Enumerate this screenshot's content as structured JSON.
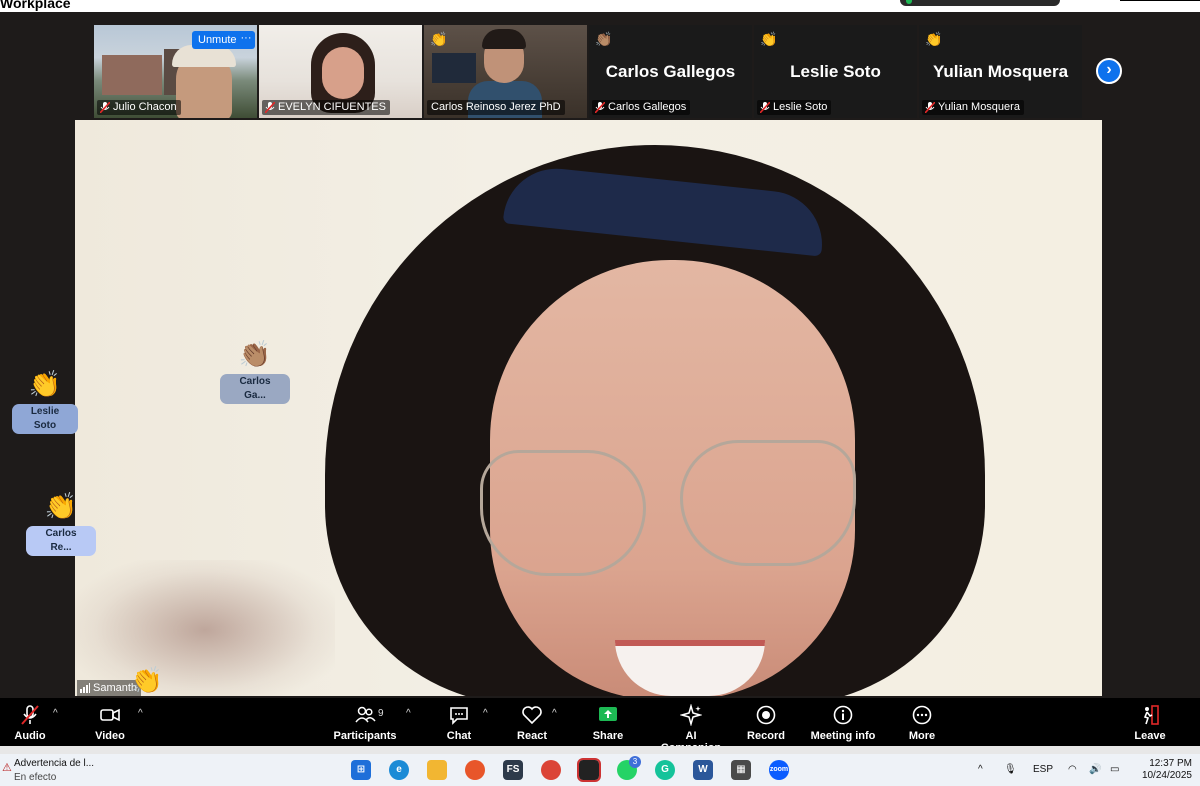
{
  "app": {
    "title": "Workplace"
  },
  "thumbnails": [
    {
      "name": "Julio Chacon",
      "kind": "video",
      "muted": true,
      "unmute_label": "Unmute",
      "more_label": "···"
    },
    {
      "name": "EVELYN CIFUENTES",
      "kind": "video",
      "muted": true
    },
    {
      "name": "Carlos Reinoso Jerez PhD",
      "kind": "video",
      "muted": false,
      "reaction": "👏"
    },
    {
      "name": "Carlos Gallegos",
      "kind": "name",
      "display": "Carlos Gallegos",
      "muted": true,
      "reaction": "👏🏽"
    },
    {
      "name": "Leslie Soto",
      "kind": "name",
      "display": "Leslie Soto",
      "muted": true,
      "reaction": "👏"
    },
    {
      "name": "Yulian Mosquera",
      "kind": "name",
      "display": "Yulian Mosquera",
      "muted": true,
      "reaction": "👏"
    }
  ],
  "next_icon": "›",
  "main": {
    "speaker_label": "Samanth"
  },
  "floating_reactions": [
    {
      "emoji": "👏🏽",
      "label": "Carlos Ga...",
      "color": "#9aa8c2"
    },
    {
      "emoji": "👏",
      "label": "Leslie Soto",
      "color": "#8fa7d6"
    },
    {
      "emoji": "👏",
      "label": "Carlos Re...",
      "color": "#b8c9f5"
    },
    {
      "emoji": "👏"
    }
  ],
  "toolbar": {
    "audio": "Audio",
    "video": "Video",
    "participants": "Participants",
    "participants_count": "9",
    "chat": "Chat",
    "react": "React",
    "share": "Share",
    "ai_companion": "AI Companion",
    "record": "Record",
    "meeting_info": "Meeting info",
    "more": "More",
    "leave": "Leave",
    "caret": "^"
  },
  "taskbar": {
    "notice_title": "Advertencia de l...",
    "notice_sub": "En efecto",
    "whatsapp_badge": "3",
    "lang": "ESP",
    "time": "12:37 PM",
    "date": "10/24/2025"
  },
  "colors": {
    "accent": "#0e72ed",
    "share_green": "#1db954"
  }
}
